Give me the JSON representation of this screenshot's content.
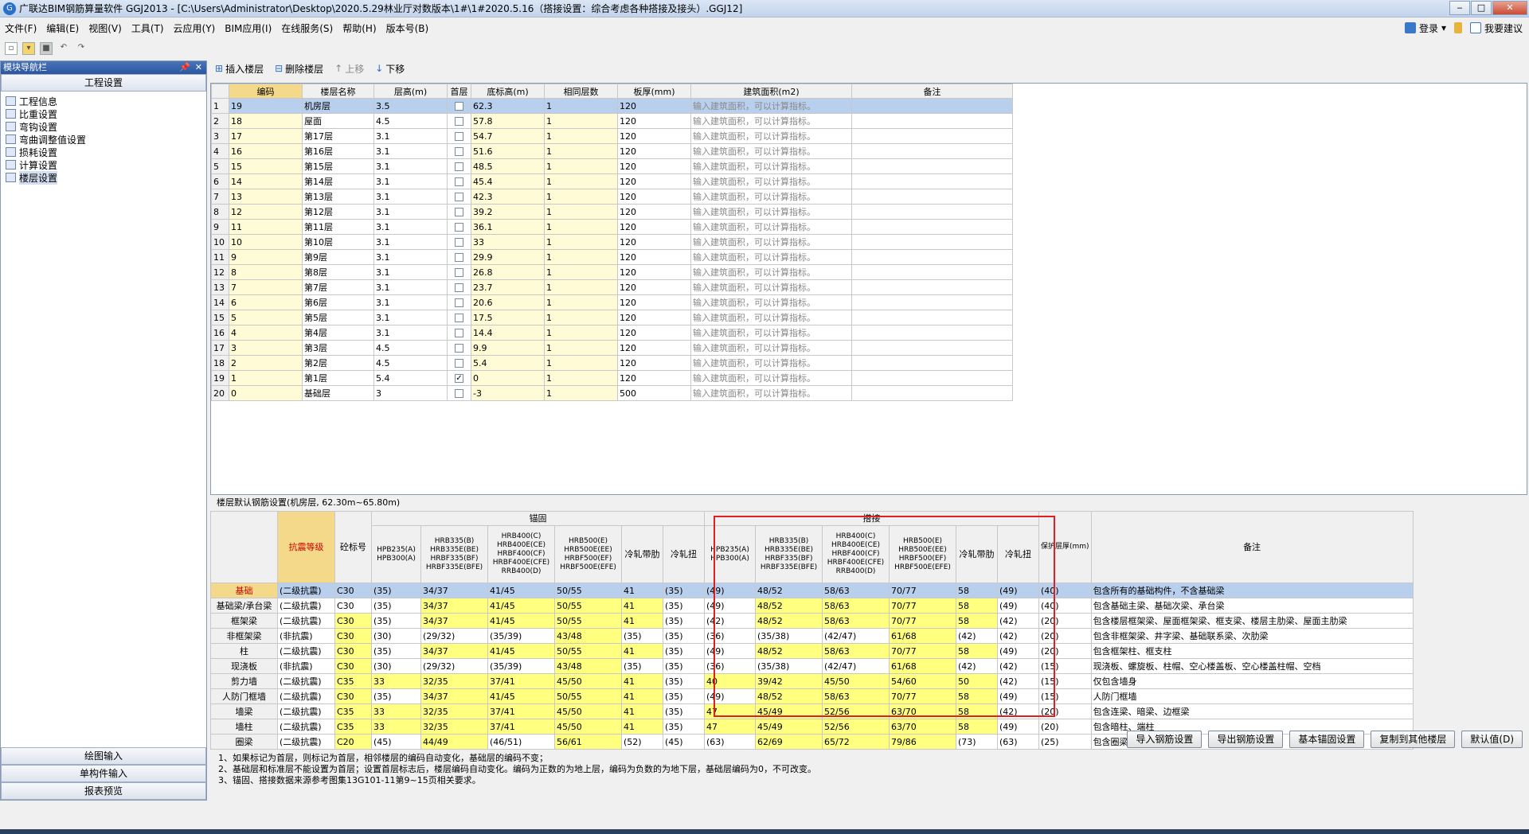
{
  "window": {
    "title": "广联达BIM钢筋算量软件 GGJ2013 - [C:\\Users\\Administrator\\Desktop\\2020.5.29林业厅对数版本\\1#\\1#2020.5.16（搭接设置：综合考虑各种搭接及接头）.GGJ12]"
  },
  "menu": [
    "文件(F)",
    "编辑(E)",
    "视图(V)",
    "工具(T)",
    "云应用(Y)",
    "BIM应用(I)",
    "在线服务(S)",
    "帮助(H)",
    "版本号(B)"
  ],
  "menu_right": {
    "login": "登录",
    "suggest": "我要建议"
  },
  "nav": {
    "title": "模块导航栏",
    "section": "工程设置",
    "items": [
      "工程信息",
      "比重设置",
      "弯钩设置",
      "弯曲调整值设置",
      "损耗设置",
      "计算设置",
      "楼层设置"
    ],
    "selected": 6,
    "bottom": [
      "绘图输入",
      "单构件输入",
      "报表预览"
    ]
  },
  "floor_toolbar": {
    "insert": "插入楼层",
    "delete": "删除楼层",
    "up": "上移",
    "down": "下移"
  },
  "floor_table": {
    "headers": [
      "编码",
      "楼层名称",
      "层高(m)",
      "首层",
      "底标高(m)",
      "相同层数",
      "板厚(mm)",
      "建筑面积(m2)",
      "备注"
    ],
    "placeholder": "输入建筑面积，可以计算指标。",
    "rows": [
      {
        "n": "1",
        "code": "19",
        "name": "机房层",
        "h": "3.5",
        "first": false,
        "base": "62.3",
        "same": "1",
        "slab": "120"
      },
      {
        "n": "2",
        "code": "18",
        "name": "屋面",
        "h": "4.5",
        "first": false,
        "base": "57.8",
        "same": "1",
        "slab": "120"
      },
      {
        "n": "3",
        "code": "17",
        "name": "第17层",
        "h": "3.1",
        "first": false,
        "base": "54.7",
        "same": "1",
        "slab": "120"
      },
      {
        "n": "4",
        "code": "16",
        "name": "第16层",
        "h": "3.1",
        "first": false,
        "base": "51.6",
        "same": "1",
        "slab": "120"
      },
      {
        "n": "5",
        "code": "15",
        "name": "第15层",
        "h": "3.1",
        "first": false,
        "base": "48.5",
        "same": "1",
        "slab": "120"
      },
      {
        "n": "6",
        "code": "14",
        "name": "第14层",
        "h": "3.1",
        "first": false,
        "base": "45.4",
        "same": "1",
        "slab": "120"
      },
      {
        "n": "7",
        "code": "13",
        "name": "第13层",
        "h": "3.1",
        "first": false,
        "base": "42.3",
        "same": "1",
        "slab": "120"
      },
      {
        "n": "8",
        "code": "12",
        "name": "第12层",
        "h": "3.1",
        "first": false,
        "base": "39.2",
        "same": "1",
        "slab": "120"
      },
      {
        "n": "9",
        "code": "11",
        "name": "第11层",
        "h": "3.1",
        "first": false,
        "base": "36.1",
        "same": "1",
        "slab": "120"
      },
      {
        "n": "10",
        "code": "10",
        "name": "第10层",
        "h": "3.1",
        "first": false,
        "base": "33",
        "same": "1",
        "slab": "120"
      },
      {
        "n": "11",
        "code": "9",
        "name": "第9层",
        "h": "3.1",
        "first": false,
        "base": "29.9",
        "same": "1",
        "slab": "120"
      },
      {
        "n": "12",
        "code": "8",
        "name": "第8层",
        "h": "3.1",
        "first": false,
        "base": "26.8",
        "same": "1",
        "slab": "120"
      },
      {
        "n": "13",
        "code": "7",
        "name": "第7层",
        "h": "3.1",
        "first": false,
        "base": "23.7",
        "same": "1",
        "slab": "120"
      },
      {
        "n": "14",
        "code": "6",
        "name": "第6层",
        "h": "3.1",
        "first": false,
        "base": "20.6",
        "same": "1",
        "slab": "120"
      },
      {
        "n": "15",
        "code": "5",
        "name": "第5层",
        "h": "3.1",
        "first": false,
        "base": "17.5",
        "same": "1",
        "slab": "120"
      },
      {
        "n": "16",
        "code": "4",
        "name": "第4层",
        "h": "3.1",
        "first": false,
        "base": "14.4",
        "same": "1",
        "slab": "120"
      },
      {
        "n": "17",
        "code": "3",
        "name": "第3层",
        "h": "4.5",
        "first": false,
        "base": "9.9",
        "same": "1",
        "slab": "120"
      },
      {
        "n": "18",
        "code": "2",
        "name": "第2层",
        "h": "4.5",
        "first": false,
        "base": "5.4",
        "same": "1",
        "slab": "120"
      },
      {
        "n": "19",
        "code": "1",
        "name": "第1层",
        "h": "5.4",
        "first": true,
        "base": "0",
        "same": "1",
        "slab": "120"
      },
      {
        "n": "20",
        "code": "0",
        "name": "基础层",
        "h": "3",
        "first": false,
        "base": "-3",
        "same": "1",
        "slab": "500"
      }
    ]
  },
  "rebar": {
    "title": "楼层默认钢筋设置(机房层, 62.30m~65.80m)",
    "group_anchor": "锚固",
    "group_lap": "搭接",
    "h_seismic": "抗震等级",
    "h_concrete": "砼标号",
    "h_cover": "保护层厚(mm)",
    "h_note": "备注",
    "subheaders": [
      "HPB235(A)\nHPB300(A)",
      "HRB335(B)\nHRB335E(BE)\nHRBF335(BF)\nHRBF335E(BFE)",
      "HRB400(C)\nHRB400E(CE)\nHRBF400(CF)\nHRBF400E(CFE)\nRRB400(D)",
      "HRB500(E)\nHRB500E(EE)\nHRBF500(EF)\nHRBF500E(EFE)",
      "冷轧带肋",
      "冷轧扭"
    ],
    "rows": [
      {
        "name": "基础",
        "seis": "(二级抗震)",
        "c": "C30",
        "a": [
          "(35)",
          "34/37",
          "41/45",
          "50/55",
          "41",
          "(35)"
        ],
        "l": [
          "(49)",
          "48/52",
          "58/63",
          "70/77",
          "58",
          "(49)"
        ],
        "cover": "(40)",
        "note": "包含所有的基础构件，不含基础梁"
      },
      {
        "name": "基础梁/承台梁",
        "seis": "(二级抗震)",
        "c": "C30",
        "a": [
          "(35)",
          "34/37",
          "41/45",
          "50/55",
          "41",
          "(35)"
        ],
        "l": [
          "(49)",
          "48/52",
          "58/63",
          "70/77",
          "58",
          "(49)"
        ],
        "cover": "(40)",
        "note": "包含基础主梁、基础次梁、承台梁"
      },
      {
        "name": "框架梁",
        "seis": "(二级抗震)",
        "c": "C30",
        "a": [
          "(35)",
          "34/37",
          "41/45",
          "50/55",
          "41",
          "(35)"
        ],
        "l": [
          "(42)",
          "48/52",
          "58/63",
          "70/77",
          "58",
          "(42)"
        ],
        "cover": "(20)",
        "note": "包含楼层框架梁、屋面框架梁、框支梁、楼层主肋梁、屋面主肋梁"
      },
      {
        "name": "非框架梁",
        "seis": "(非抗震)",
        "c": "C30",
        "a": [
          "(30)",
          "(29/32)",
          "(35/39)",
          "43/48",
          "(35)",
          "(35)"
        ],
        "l": [
          "(36)",
          "(35/38)",
          "(42/47)",
          "61/68",
          "(42)",
          "(42)"
        ],
        "cover": "(20)",
        "note": "包含非框架梁、井字梁、基础联系梁、次肋梁"
      },
      {
        "name": "柱",
        "seis": "(二级抗震)",
        "c": "C30",
        "a": [
          "(35)",
          "34/37",
          "41/45",
          "50/55",
          "41",
          "(35)"
        ],
        "l": [
          "(49)",
          "48/52",
          "58/63",
          "70/77",
          "58",
          "(49)"
        ],
        "cover": "(20)",
        "note": "包含框架柱、框支柱"
      },
      {
        "name": "现浇板",
        "seis": "(非抗震)",
        "c": "C30",
        "a": [
          "(30)",
          "(29/32)",
          "(35/39)",
          "43/48",
          "(35)",
          "(35)"
        ],
        "l": [
          "(36)",
          "(35/38)",
          "(42/47)",
          "61/68",
          "(42)",
          "(42)"
        ],
        "cover": "(15)",
        "note": "现浇板、螺旋板、柱帽、空心楼盖板、空心楼盖柱帽、空档"
      },
      {
        "name": "剪力墙",
        "seis": "(二级抗震)",
        "c": "C35",
        "a": [
          "33",
          "32/35",
          "37/41",
          "45/50",
          "41",
          "(35)"
        ],
        "l": [
          "40",
          "39/42",
          "45/50",
          "54/60",
          "50",
          "(42)"
        ],
        "cover": "(15)",
        "note": "仅包含墙身"
      },
      {
        "name": "人防门框墙",
        "seis": "(二级抗震)",
        "c": "C30",
        "a": [
          "(35)",
          "34/37",
          "41/45",
          "50/55",
          "41",
          "(35)"
        ],
        "l": [
          "(49)",
          "48/52",
          "58/63",
          "70/77",
          "58",
          "(49)"
        ],
        "cover": "(15)",
        "note": "人防门框墙"
      },
      {
        "name": "墙梁",
        "seis": "(二级抗震)",
        "c": "C35",
        "a": [
          "33",
          "32/35",
          "37/41",
          "45/50",
          "41",
          "(35)"
        ],
        "l": [
          "47",
          "45/49",
          "52/56",
          "63/70",
          "58",
          "(42)"
        ],
        "cover": "(20)",
        "note": "包含连梁、暗梁、边框梁"
      },
      {
        "name": "墙柱",
        "seis": "(二级抗震)",
        "c": "C35",
        "a": [
          "33",
          "32/35",
          "37/41",
          "45/50",
          "41",
          "(35)"
        ],
        "l": [
          "47",
          "45/49",
          "52/56",
          "63/70",
          "58",
          "(49)"
        ],
        "cover": "(20)",
        "note": "包含暗柱、端柱"
      },
      {
        "name": "圈梁",
        "seis": "(二级抗震)",
        "c": "C20",
        "a": [
          "(45)",
          "44/49",
          "(46/51)",
          "56/61",
          "(52)",
          "(45)"
        ],
        "l": [
          "(63)",
          "62/69",
          "65/72",
          "79/86",
          "(73)",
          "(63)"
        ],
        "cover": "(25)",
        "note": "包含圈梁、过梁"
      }
    ]
  },
  "buttons": [
    "导入钢筋设置",
    "导出钢筋设置",
    "基本锚固设置",
    "复制到其他楼层",
    "默认值(D)"
  ],
  "notes": [
    "1、如果标记为首层，则标记为首层，相邻楼层的编码自动变化，基础层的编码不变；",
    "2、基础层和标准层不能设置为首层；设置首层标志后，楼层编码自动变化。编码为正数的为地上层，编码为负数的为地下层，基础层编码为0，不可改变。",
    "3、锚固、搭接数据来源参考图集13G101-11第9~15页相关要求。"
  ],
  "colors": {
    "accent": "#b9cfee",
    "highlight": "#ffff80",
    "header_hl": "#f5d98a",
    "redbox": "#e02020"
  }
}
